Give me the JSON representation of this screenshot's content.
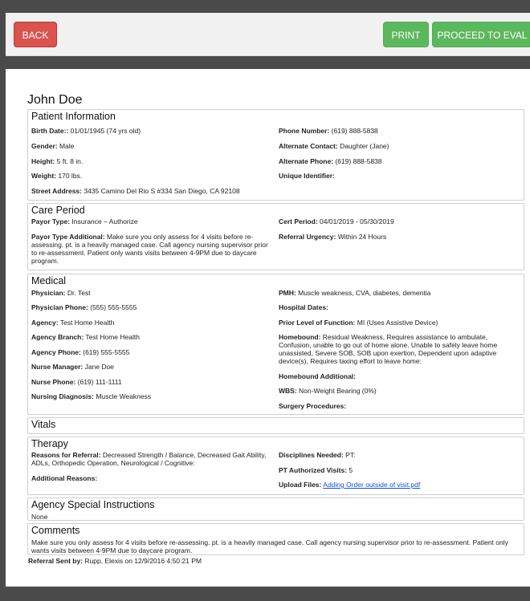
{
  "toolbar": {
    "back_label": "BACK",
    "print_label": "PRINT",
    "proceed_label": "PROCEED TO EVAL"
  },
  "patient_name": "John Doe",
  "patient_information": {
    "title": "Patient Information",
    "birth_date_label": "Birth Date::",
    "birth_date": "01/01/1945 (74 yrs old)",
    "gender_label": "Gender:",
    "gender": "Male",
    "height_label": "Height:",
    "height": "5 ft. 8 in.",
    "weight_label": "Weight:",
    "weight": "170 lbs.",
    "street_label": "Street Address:",
    "street": "3435 Camino Del Rio S #334 San Diego, CA 92108",
    "phone_label": "Phone Number:",
    "phone": "(619) 888-5838",
    "alt_contact_label": "Alternate Contact:",
    "alt_contact": "Daughter (Jane)",
    "alt_phone_label": "Alternate Phone:",
    "alt_phone": "(619) 888-5838",
    "unique_id_label": "Unique Identifier:",
    "unique_id": ""
  },
  "care_period": {
    "title": "Care Period",
    "payor_type_label": "Payor Type:",
    "payor_type": "Insurance – Authorize",
    "payor_additional_label": "Payor Type Additional:",
    "payor_additional": "Make sure you only assess for 4 visits before re-assessing. pt. is a heavily managed case. Call agency nursing supervisor prior to re-assessment. Patient only wants visits between 4-9PM due to daycare program.",
    "cert_period_label": "Cert Period:",
    "cert_period": "04/01/2019 - 05/30/2019",
    "referral_urgency_label": "Referral Urgency:",
    "referral_urgency": "Within 24 Hours"
  },
  "medical": {
    "title": "Medical",
    "physician_label": "Physician:",
    "physician": "Dr. Test",
    "physician_phone_label": "Physician Phone:",
    "physician_phone": "(555) 555-5555",
    "agency_label": "Agency:",
    "agency": "Test Home Health",
    "agency_branch_label": "Agency Branch:",
    "agency_branch": "Test Home Health",
    "agency_phone_label": "Agency Phone:",
    "agency_phone": "(619) 555-5555",
    "nurse_manager_label": "Nurse Manager:",
    "nurse_manager": "Jane Doe",
    "nurse_phone_label": "Nurse Phone:",
    "nurse_phone": "(619) 111-1111",
    "nursing_diagnosis_label": "Nursing Diagnosis:",
    "nursing_diagnosis": "Muscle Weakness",
    "pmh_label": "PMH:",
    "pmh": "Muscle weakness, CVA, diabetes, dementia",
    "hospital_dates_label": "Hospital Dates:",
    "hospital_dates": "",
    "prior_function_label": "Prior Level of Function:",
    "prior_function": "MI (Uses Assistive Device)",
    "homebound_label": "Homebound:",
    "homebound": "Residual Weakness, Requires assistance to ambulate, Confusion, unable to go out of home alone. Unable to safely leave home unassisted, Severe SOB, SOB upon exertion, Dependent upon adaptive device(s), Requires taxing effort to leave home:",
    "homebound_additional_label": "Homebound Additional:",
    "homebound_additional": "",
    "wbs_label": "WBS:",
    "wbs": "Non-Weight Bearing (0%)",
    "surgery_label": "Surgery Procedures:",
    "surgery": ""
  },
  "vitals": {
    "title": "Vitals"
  },
  "therapy": {
    "title": "Therapy",
    "reasons_label": "Reasons for Referral:",
    "reasons": "Decreased Strength / Balance, Decreased Gait Ability, ADLs, Orthopedic Operation, Neurological / Cognitive:",
    "additional_reasons_label": "Additional Reasons:",
    "additional_reasons": "",
    "disciplines_label": "Disciplines Needed:",
    "disciplines": "PT:",
    "pt_visits_label": "PT Authorized Visits:",
    "pt_visits": "5",
    "upload_label": "Upload Files:",
    "upload_file": "Adding Order outside of visit.pdf"
  },
  "agency_instructions": {
    "title": "Agency Special Instructions",
    "text": "None"
  },
  "comments": {
    "title": "Comments",
    "text": "Make sure you only assess for 4 visits before re-assessing. pt. is a heavily managed case. Call agency nursing supervisor prior to re-assessment. Patient only wants visits between 4-9PM due to daycare program."
  },
  "referral_sent": {
    "label": "Referral Sent by:",
    "value": "Rupp, Elexis on 12/9/2016 4:50:21 PM"
  },
  "colors": {
    "back_button": "#d9534f",
    "primary_button": "#5cb85c",
    "link": "#1a4fd6"
  }
}
